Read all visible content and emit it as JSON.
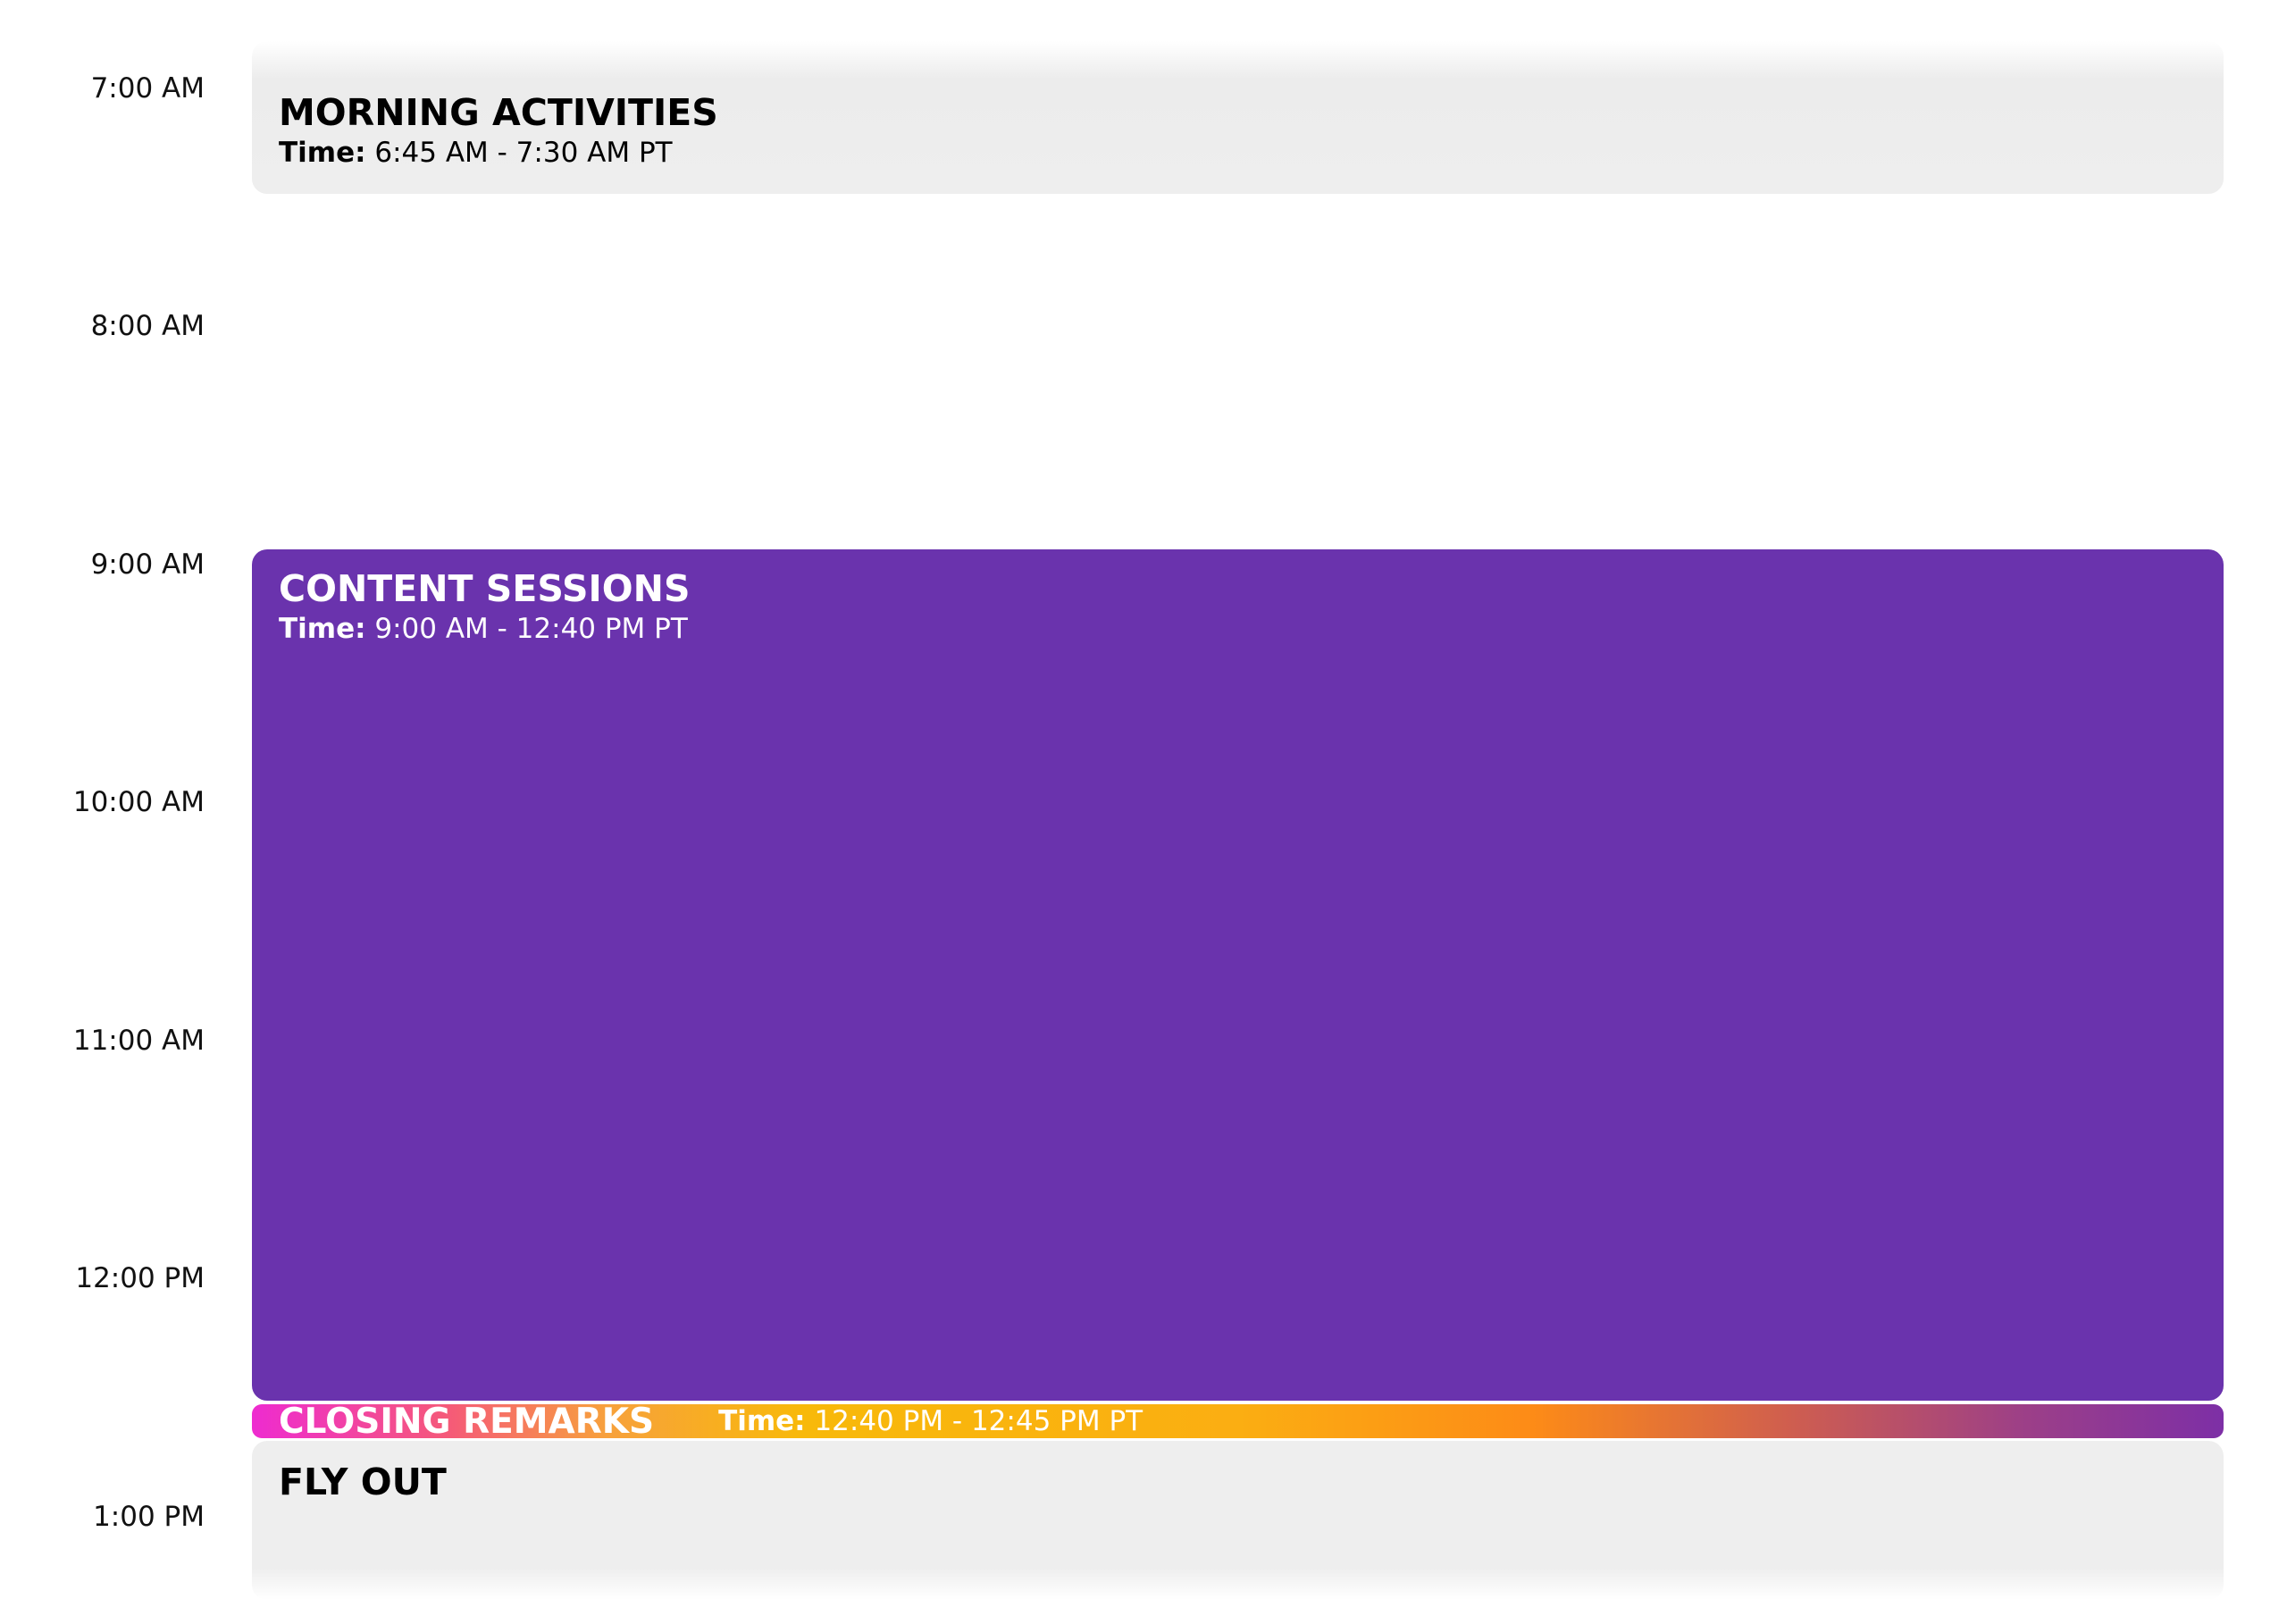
{
  "schedule": {
    "time_labels": [
      "7:00 AM",
      "8:00 AM",
      "9:00 AM",
      "10:00 AM",
      "11:00 AM",
      "12:00 PM",
      "1:00 PM"
    ],
    "events": {
      "morning": {
        "title": "MORNING ACTIVITIES",
        "time_label": "Time:",
        "time_value": "6:45 AM - 7:30 AM PT"
      },
      "content": {
        "title": "CONTENT SESSIONS",
        "time_label": "Time:",
        "time_value": "9:00 AM - 12:40 PM PT"
      },
      "closing": {
        "title": "CLOSING REMARKS",
        "time_label": "Time:",
        "time_value": "12:40 PM - 12:45 PM PT"
      },
      "flyout": {
        "title": "FLY OUT"
      }
    }
  },
  "colors": {
    "content_sessions_bg": "#6a33ad",
    "gray_event_bg": "#eeeeee",
    "closing_gradient": [
      "#ee2bd0",
      "#f8b90a",
      "#fd8b17",
      "#7d2fa6"
    ]
  }
}
